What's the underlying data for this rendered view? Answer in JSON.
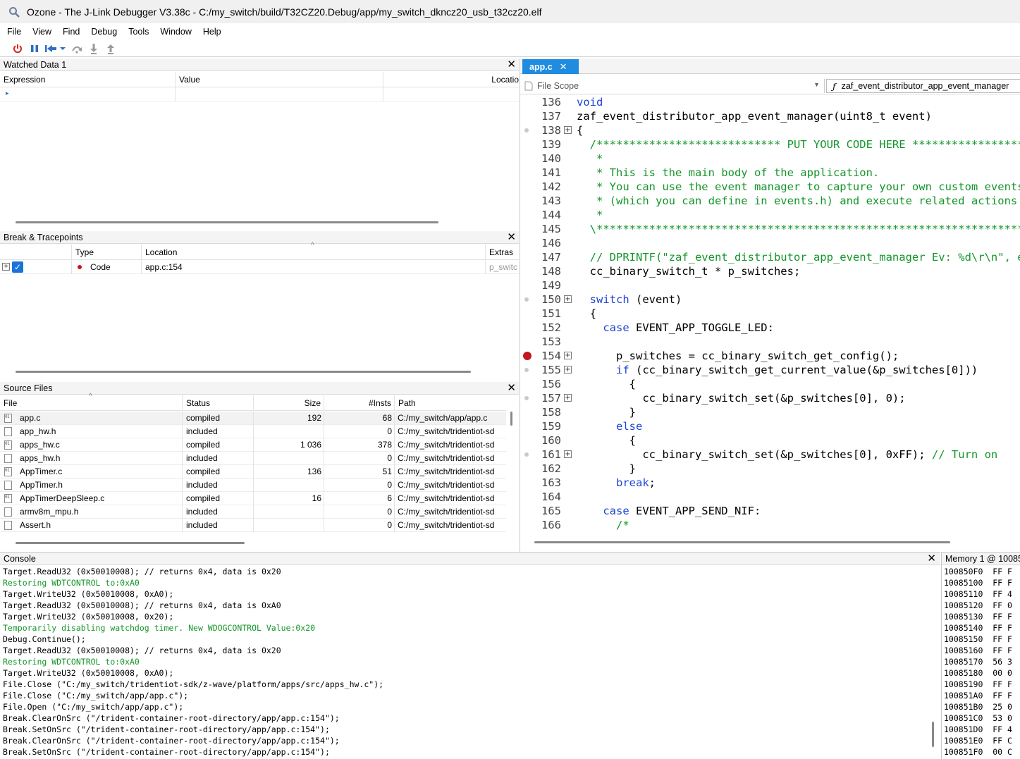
{
  "window": {
    "title": "Ozone - The J-Link Debugger V3.38c - C:/my_switch/build/T32CZ20.Debug/app/my_switch_dkncz20_usb_t32cz20.elf"
  },
  "menu": [
    "File",
    "View",
    "Find",
    "Debug",
    "Tools",
    "Window",
    "Help"
  ],
  "toolbar": {
    "icons": [
      "power-icon",
      "pause-icon",
      "reset-icon",
      "step-over-icon",
      "step-into-icon",
      "step-out-icon"
    ]
  },
  "watched": {
    "title": "Watched Data 1",
    "columns": [
      "Expression",
      "Value",
      "Locatio"
    ]
  },
  "breaks": {
    "title": "Break & Tracepoints",
    "columns": [
      "Type",
      "Location",
      "Extras"
    ],
    "rows": [
      {
        "type": "Code",
        "location": "app.c:154",
        "extras": "p_switc"
      }
    ]
  },
  "sources": {
    "title": "Source Files",
    "columns": [
      "File",
      "Status",
      "Size",
      "#Insts",
      "Path"
    ],
    "rows": [
      {
        "file": "app.c",
        "status": "compiled",
        "size": "192",
        "insts": "68",
        "path": "C:/my_switch/app/app.c",
        "kind": "src"
      },
      {
        "file": "app_hw.h",
        "status": "included",
        "size": "",
        "insts": "0",
        "path": "C:/my_switch/tridentiot-sd",
        "kind": "hdr"
      },
      {
        "file": "apps_hw.c",
        "status": "compiled",
        "size": "1 036",
        "insts": "378",
        "path": "C:/my_switch/tridentiot-sd",
        "kind": "src"
      },
      {
        "file": "apps_hw.h",
        "status": "included",
        "size": "",
        "insts": "0",
        "path": "C:/my_switch/tridentiot-sd",
        "kind": "hdr"
      },
      {
        "file": "AppTimer.c",
        "status": "compiled",
        "size": "136",
        "insts": "51",
        "path": "C:/my_switch/tridentiot-sd",
        "kind": "src"
      },
      {
        "file": "AppTimer.h",
        "status": "included",
        "size": "",
        "insts": "0",
        "path": "C:/my_switch/tridentiot-sd",
        "kind": "hdr"
      },
      {
        "file": "AppTimerDeepSleep.c",
        "status": "compiled",
        "size": "16",
        "insts": "6",
        "path": "C:/my_switch/tridentiot-sd",
        "kind": "src"
      },
      {
        "file": "armv8m_mpu.h",
        "status": "included",
        "size": "",
        "insts": "0",
        "path": "C:/my_switch/tridentiot-sd",
        "kind": "hdr"
      },
      {
        "file": "Assert.h",
        "status": "included",
        "size": "",
        "insts": "0",
        "path": "C:/my_switch/tridentiot-sd",
        "kind": "hdr"
      }
    ]
  },
  "editor": {
    "tab": "app.c",
    "scope_left": "File Scope",
    "scope_right": "zaf_event_distributor_app_event_manager",
    "lines": [
      {
        "n": "136",
        "parts": [
          {
            "t": "void",
            "c": "kw"
          }
        ]
      },
      {
        "n": "137",
        "parts": [
          {
            "t": "zaf_event_distributor_app_event_manager(uint8_t event)",
            "c": ""
          }
        ]
      },
      {
        "n": "138",
        "mark": "dot",
        "exp": true,
        "parts": [
          {
            "t": "{",
            "c": ""
          }
        ]
      },
      {
        "n": "139",
        "parts": [
          {
            "t": "  /**************************** PUT YOUR CODE HERE ****************************",
            "c": "cm"
          }
        ]
      },
      {
        "n": "140",
        "parts": [
          {
            "t": "   *",
            "c": "cm"
          }
        ]
      },
      {
        "n": "141",
        "parts": [
          {
            "t": "   * This is the main body of the application.",
            "c": "cm"
          }
        ]
      },
      {
        "n": "142",
        "parts": [
          {
            "t": "   * You can use the event manager to capture your own custom events",
            "c": "cm"
          }
        ]
      },
      {
        "n": "143",
        "parts": [
          {
            "t": "   * (which you can define in events.h) and execute related actions",
            "c": "cm"
          }
        ]
      },
      {
        "n": "144",
        "parts": [
          {
            "t": "   *",
            "c": "cm"
          }
        ]
      },
      {
        "n": "145",
        "parts": [
          {
            "t": "  \\*****************************************************************************/",
            "c": "cm"
          }
        ]
      },
      {
        "n": "146",
        "parts": []
      },
      {
        "n": "147",
        "parts": [
          {
            "t": "  // DPRINTF(\"zaf_event_distributor_app_event_manager Ev: %d\\r\\n\", event);",
            "c": "cm"
          }
        ]
      },
      {
        "n": "148",
        "parts": [
          {
            "t": "  cc_binary_switch_t * p_switches;",
            "c": ""
          }
        ]
      },
      {
        "n": "149",
        "parts": []
      },
      {
        "n": "150",
        "mark": "dot",
        "exp": true,
        "parts": [
          {
            "t": "  ",
            "c": ""
          },
          {
            "t": "switch",
            "c": "kw"
          },
          {
            "t": " (event)",
            "c": ""
          }
        ]
      },
      {
        "n": "151",
        "parts": [
          {
            "t": "  {",
            "c": ""
          }
        ]
      },
      {
        "n": "152",
        "parts": [
          {
            "t": "    ",
            "c": ""
          },
          {
            "t": "case",
            "c": "kw"
          },
          {
            "t": " EVENT_APP_TOGGLE_LED:",
            "c": ""
          }
        ]
      },
      {
        "n": "153",
        "parts": []
      },
      {
        "n": "154",
        "mark": "bp",
        "exp": true,
        "parts": [
          {
            "t": "      p_switches = cc_binary_switch_get_config();",
            "c": ""
          }
        ]
      },
      {
        "n": "155",
        "mark": "dot",
        "exp": true,
        "parts": [
          {
            "t": "      ",
            "c": ""
          },
          {
            "t": "if",
            "c": "kw"
          },
          {
            "t": " (cc_binary_switch_get_current_value(&p_switches[0]))",
            "c": ""
          }
        ]
      },
      {
        "n": "156",
        "parts": [
          {
            "t": "        {",
            "c": ""
          }
        ]
      },
      {
        "n": "157",
        "mark": "dot",
        "exp": true,
        "parts": [
          {
            "t": "          cc_binary_switch_set(&p_switches[0], 0);",
            "c": ""
          }
        ]
      },
      {
        "n": "158",
        "parts": [
          {
            "t": "        }",
            "c": ""
          }
        ]
      },
      {
        "n": "159",
        "parts": [
          {
            "t": "      ",
            "c": ""
          },
          {
            "t": "else",
            "c": "kw"
          }
        ]
      },
      {
        "n": "160",
        "parts": [
          {
            "t": "        {",
            "c": ""
          }
        ]
      },
      {
        "n": "161",
        "mark": "dot",
        "exp": true,
        "parts": [
          {
            "t": "          cc_binary_switch_set(&p_switches[0], 0xFF); ",
            "c": ""
          },
          {
            "t": "// Turn on",
            "c": "cm"
          }
        ]
      },
      {
        "n": "162",
        "parts": [
          {
            "t": "        }",
            "c": ""
          }
        ]
      },
      {
        "n": "163",
        "parts": [
          {
            "t": "      ",
            "c": ""
          },
          {
            "t": "break",
            "c": "kw"
          },
          {
            "t": ";",
            "c": ""
          }
        ]
      },
      {
        "n": "164",
        "parts": []
      },
      {
        "n": "165",
        "parts": [
          {
            "t": "    ",
            "c": ""
          },
          {
            "t": "case",
            "c": "kw"
          },
          {
            "t": " EVENT_APP_SEND_NIF:",
            "c": ""
          }
        ]
      },
      {
        "n": "166",
        "parts": [
          {
            "t": "      /*",
            "c": "cm"
          }
        ]
      }
    ]
  },
  "console": {
    "title": "Console",
    "lines": [
      {
        "t": "Target.ReadU32 (0x50010008); // returns 0x4, data is 0x20",
        "g": false
      },
      {
        "t": "Restoring WDTCONTROL to:0xA0",
        "g": true
      },
      {
        "t": "Target.WriteU32 (0x50010008, 0xA0);",
        "g": false
      },
      {
        "t": "Target.ReadU32 (0x50010008); // returns 0x4, data is 0xA0",
        "g": false
      },
      {
        "t": "Target.WriteU32 (0x50010008, 0x20);",
        "g": false
      },
      {
        "t": "Temporarily disabling watchdog timer. New WDOGCONTROL Value:0x20",
        "g": true
      },
      {
        "t": "Debug.Continue();",
        "g": false
      },
      {
        "t": "Target.ReadU32 (0x50010008); // returns 0x4, data is 0x20",
        "g": false
      },
      {
        "t": "Restoring WDTCONTROL to:0xA0",
        "g": true
      },
      {
        "t": "Target.WriteU32 (0x50010008, 0xA0);",
        "g": false
      },
      {
        "t": "File.Close (\"C:/my_switch/tridentiot-sdk/z-wave/platform/apps/src/apps_hw.c\");",
        "g": false
      },
      {
        "t": "File.Close (\"C:/my_switch/app/app.c\");",
        "g": false
      },
      {
        "t": "File.Open (\"C:/my_switch/app/app.c\");",
        "g": false
      },
      {
        "t": "Break.ClearOnSrc (\"/trident-container-root-directory/app/app.c:154\");",
        "g": false
      },
      {
        "t": "Break.SetOnSrc (\"/trident-container-root-directory/app/app.c:154\");",
        "g": false
      },
      {
        "t": "Break.ClearOnSrc (\"/trident-container-root-directory/app/app.c:154\");",
        "g": false
      },
      {
        "t": "Break.SetOnSrc (\"/trident-container-root-directory/app/app.c:154\");",
        "g": false
      }
    ]
  },
  "memory": {
    "title": "Memory 1 @ 10085",
    "lines": [
      "100850F0  FF F",
      "10085100  FF F",
      "10085110  FF 4",
      "10085120  FF 0",
      "10085130  FF F",
      "10085140  FF F",
      "10085150  FF F",
      "10085160  FF F",
      "10085170  56 3",
      "10085180  00 0",
      "10085190  FF F",
      "100851A0  FF F",
      "100851B0  25 0",
      "100851C0  53 0",
      "100851D0  FF 4",
      "100851E0  FF C",
      "100851F0  00 C"
    ]
  }
}
